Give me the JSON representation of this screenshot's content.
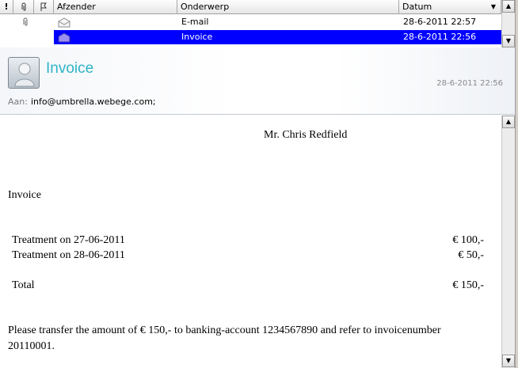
{
  "list": {
    "columns": {
      "importance": "!",
      "attachment": "paperclip-icon",
      "flag": "flag-icon",
      "from": "Afzender",
      "subject": "Onderwerp",
      "date": "Datum"
    },
    "rows": [
      {
        "subject": "E-mail",
        "date": "28-6-2011 22:57",
        "selected": false
      },
      {
        "subject": "Invoice",
        "date": "28-6-2011 22:56",
        "selected": true
      }
    ]
  },
  "header": {
    "subject": "Invoice",
    "date": "28-6-2011 22:56",
    "to_label": "Aan:",
    "to_value": "info@umbrella.webege.com;"
  },
  "message": {
    "recipient": "Mr. Chris Redfield",
    "heading": "Invoice",
    "items": [
      {
        "label": "Treatment on 27-06-2011",
        "amount": "€ 100,-"
      },
      {
        "label": "Treatment on 28-06-2011",
        "amount": "€ 50,-"
      }
    ],
    "total_label": "Total",
    "total_amount": "€ 150,-",
    "note_line1": "Please transfer the amount of € 150,- to banking-account 1234567890 and refer to invoicenumber",
    "note_line2": "20110001."
  },
  "colors": {
    "selection": "#0000ff",
    "subject_accent": "#2fb4c7"
  }
}
